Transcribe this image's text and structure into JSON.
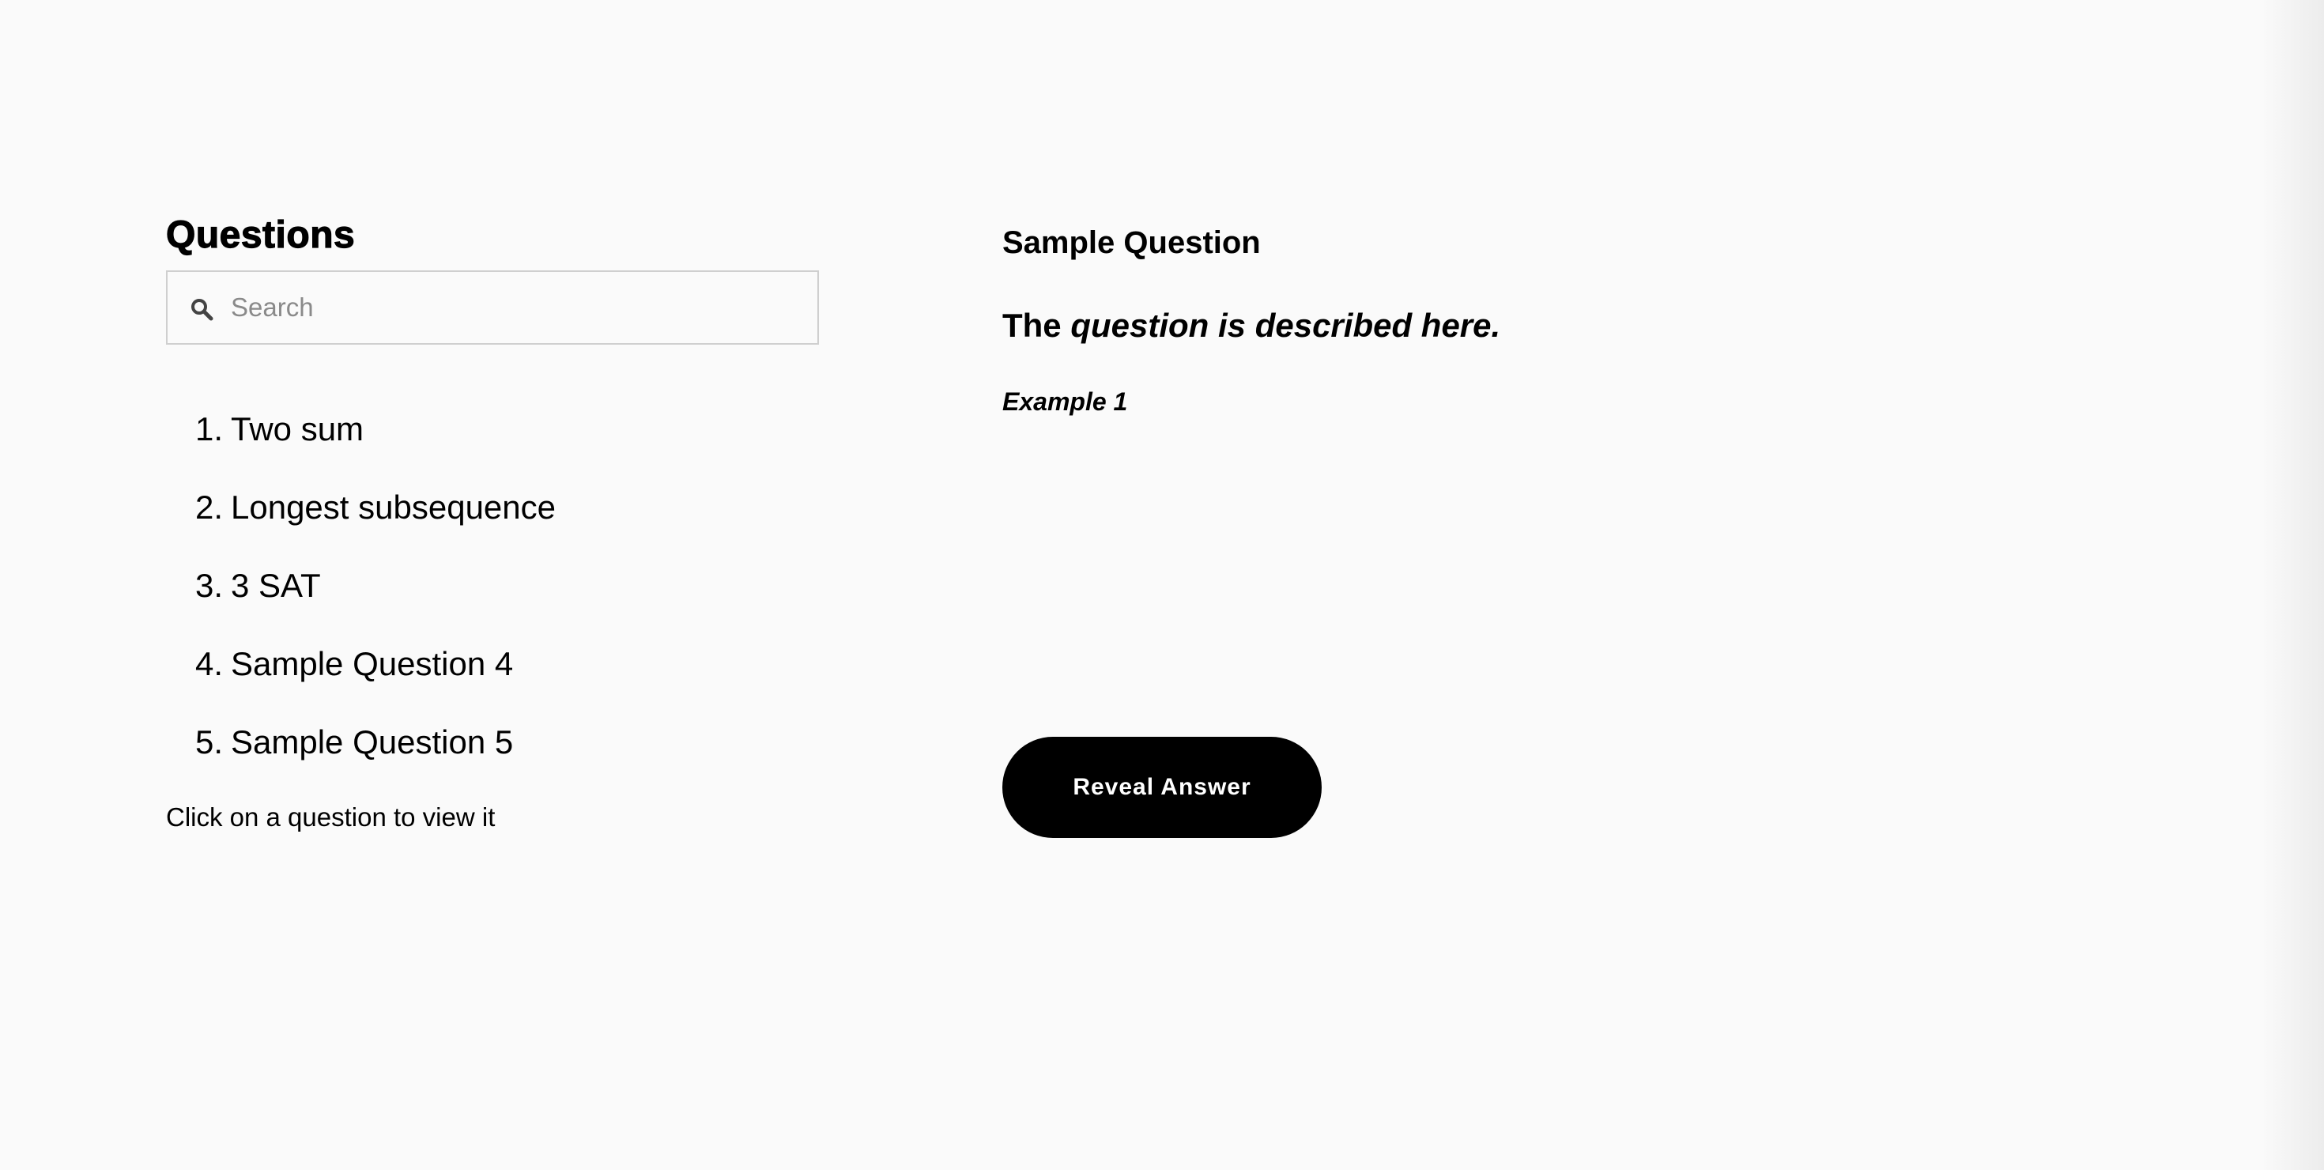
{
  "sidebar": {
    "title": "Questions",
    "search": {
      "placeholder": "Search",
      "value": "",
      "icon": "search-icon"
    },
    "questions": [
      {
        "number": "1.",
        "title": "Two sum"
      },
      {
        "number": "2.",
        "title": "Longest subsequence"
      },
      {
        "number": "3.",
        "title": "3 SAT"
      },
      {
        "number": "4.",
        "title": "Sample Question 4"
      },
      {
        "number": "5.",
        "title": "Sample Question 5"
      }
    ],
    "hint": "Click on a question to view it"
  },
  "detail": {
    "title": "Sample Question",
    "description_lead": "The ",
    "description_emphasis": "question is described here.",
    "example_label": "Example 1",
    "reveal_label": "Reveal Answer"
  },
  "colors": {
    "background": "#fafafa",
    "button": "#000000",
    "button_text": "#ffffff",
    "search_border": "#cfcfcf",
    "placeholder": "#8a8a8a"
  }
}
